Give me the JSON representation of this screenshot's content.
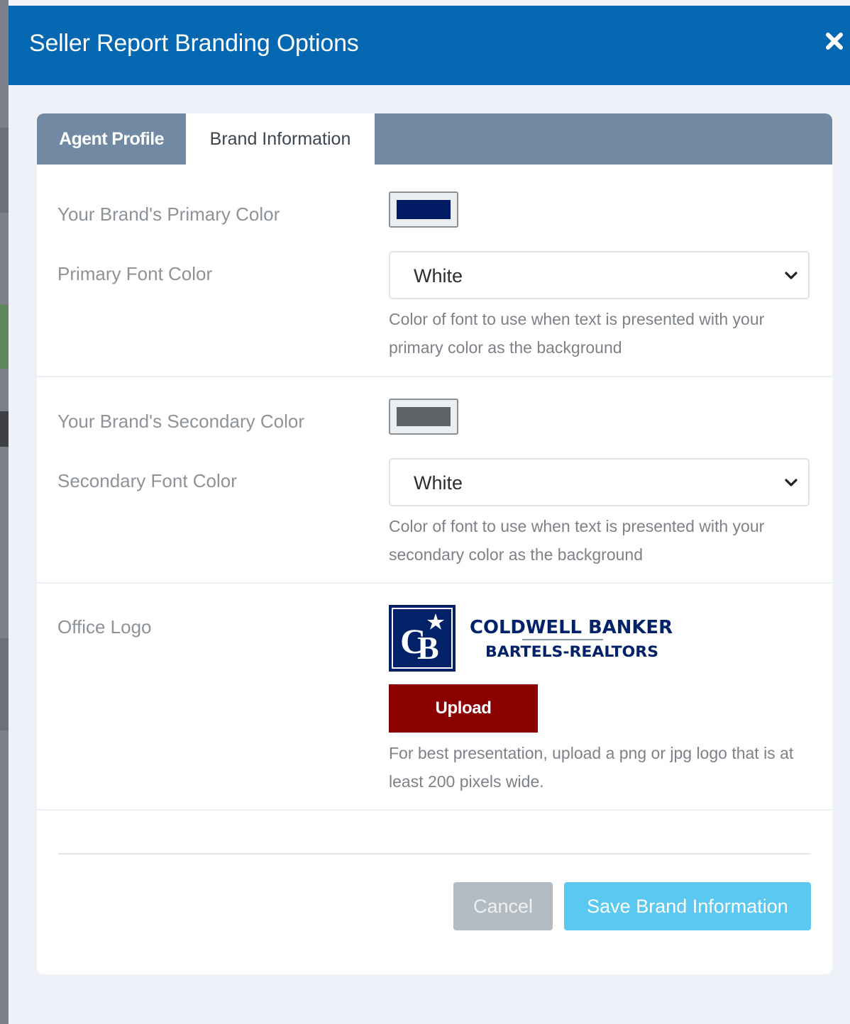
{
  "modal": {
    "title": "Seller Report Branding Options",
    "close_icon": "close-x-icon"
  },
  "tabs": [
    {
      "label": "Agent Profile",
      "active": false
    },
    {
      "label": "Brand Information",
      "active": true
    }
  ],
  "primary": {
    "color_label": "Your Brand's Primary Color",
    "color_value": "#001a66",
    "font_label": "Primary Font Color",
    "font_value": "White",
    "font_help": "Color of font to use when text is presented with your primary color as the background"
  },
  "secondary": {
    "color_label": "Your Brand's Secondary Color",
    "color_value": "#5f6368",
    "font_label": "Secondary Font Color",
    "font_value": "White",
    "font_help": "Color of font to use when text is presented with your secondary color as the background"
  },
  "logo": {
    "label": "Office Logo",
    "brand_line1": "COLDWELL BANKER",
    "brand_line2": "BARTELS-REALTORS",
    "brand_color": "#012169",
    "upload_label": "Upload",
    "help": "For best presentation, upload a png or jpg logo that is at least 200 pixels wide."
  },
  "footer": {
    "cancel_label": "Cancel",
    "save_label": "Save Brand Information"
  },
  "colors": {
    "header_bg": "#0467b2",
    "tab_bar_bg": "#7289a4",
    "upload_bg": "#8b0000",
    "save_bg": "#5ac8f0",
    "cancel_bg": "#b3bcc2"
  }
}
